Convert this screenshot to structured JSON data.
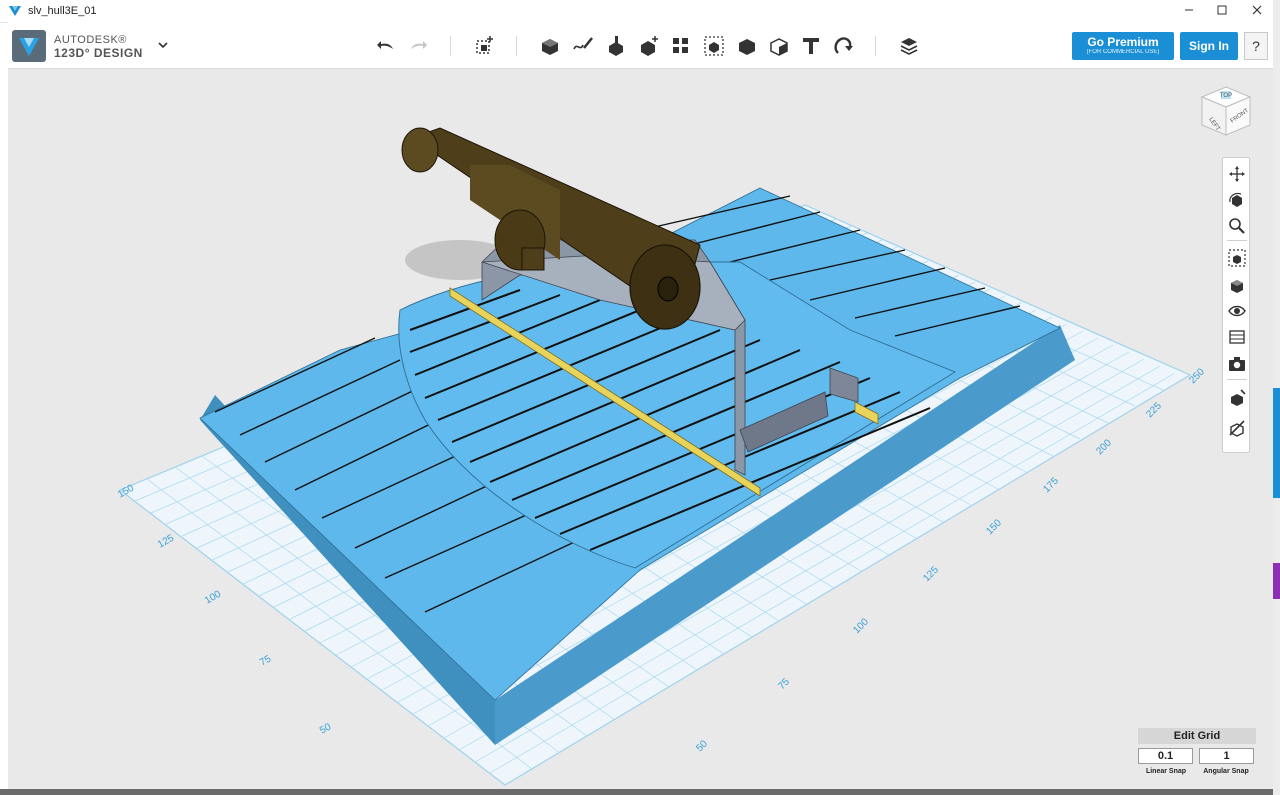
{
  "window": {
    "title": "slv_hull3E_01",
    "controls": [
      "minimize",
      "maximize",
      "close"
    ]
  },
  "brand": {
    "line1": "AUTODESK®",
    "line2": "123D° DESIGN"
  },
  "toolbar": {
    "undo_icon": "undo-icon",
    "redo_icon": "redo-icon",
    "tools": [
      "transform-icon",
      "primitives-icon",
      "sketch-icon",
      "construct-icon",
      "modify-icon",
      "pattern-icon",
      "group-icon",
      "combine-icon",
      "measure-icon",
      "text-icon",
      "snap-icon",
      "materials-icon"
    ]
  },
  "account": {
    "premium_label": "Go Premium",
    "premium_sub": "(FOR COMMERCIAL USE)",
    "signin_label": "Sign In",
    "help_label": "?"
  },
  "viewcube": {
    "top": "TOP",
    "left": "LEFT",
    "front": "FRONT"
  },
  "navbar": {
    "items": [
      "pan-icon",
      "orbit-icon",
      "zoom-icon",
      "fit-icon",
      "perspective-icon",
      "visibility-icon",
      "materials-outline-icon",
      "snapshot-icon",
      "visual-style-icon",
      "hide-icon"
    ]
  },
  "grid": {
    "left_labels": [
      "150",
      "125",
      "100",
      "75",
      "50"
    ],
    "right_labels": [
      "250",
      "225",
      "200",
      "175",
      "150",
      "125",
      "100",
      "75",
      "50"
    ]
  },
  "edit_grid": {
    "title": "Edit Grid",
    "linear_value": "0.1",
    "angular_value": "1",
    "linear_label": "Linear Snap",
    "angular_label": "Angular Snap"
  },
  "colors": {
    "accent": "#1b8fd6",
    "model_blue": "#5eb8ec",
    "model_side": "#3f8fbf",
    "cannon": "#4e3f1a",
    "carriage": "#8b96a6",
    "rail": "#e8d45a"
  }
}
